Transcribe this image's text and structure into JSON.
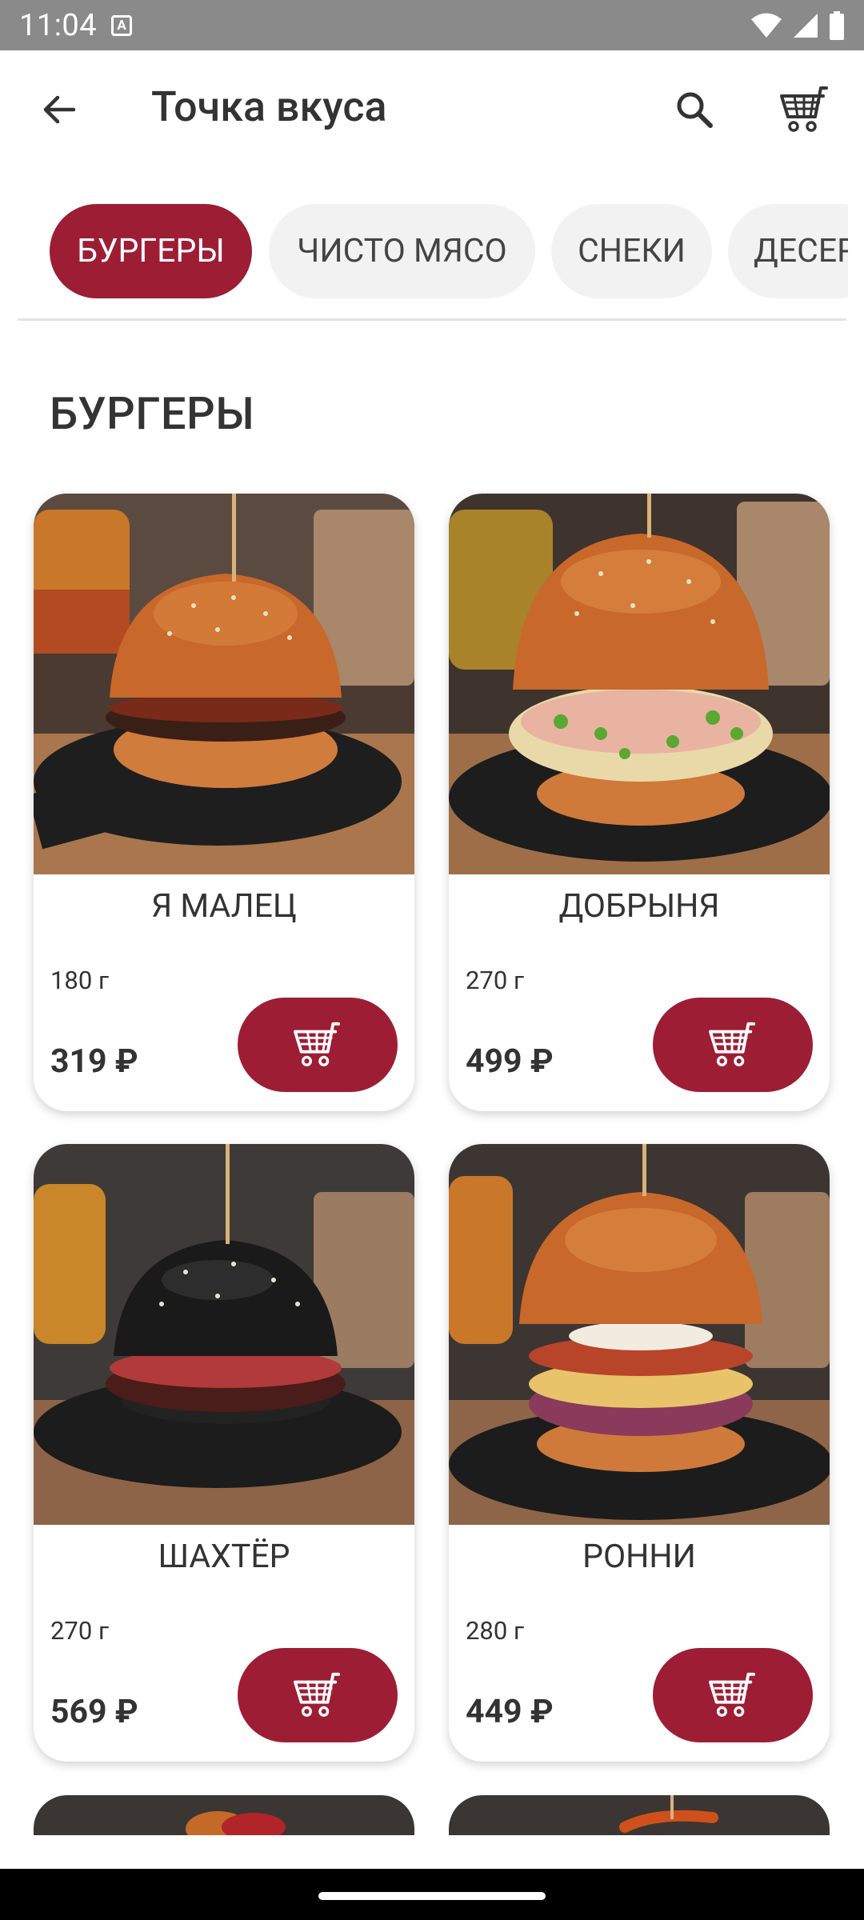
{
  "status_bar": {
    "time": "11:04",
    "badge": "A",
    "icons": [
      "wifi-icon",
      "signal-icon",
      "battery-icon"
    ]
  },
  "app_bar": {
    "title": "Точка вкуса",
    "icons": [
      "back-arrow-icon",
      "search-icon",
      "cart-icon"
    ]
  },
  "categories": [
    {
      "label": "БУРГЕРЫ",
      "active": true
    },
    {
      "label": "ЧИСТО МЯСО",
      "active": false
    },
    {
      "label": "СНЕКИ",
      "active": false
    },
    {
      "label": "ДЕСЕР",
      "active": false
    }
  ],
  "section": {
    "title": "БУРГЕРЫ"
  },
  "products": [
    {
      "name": "Я МАЛЕЦ",
      "weight": "180 г",
      "price": "319 ₽",
      "bun": "brioche"
    },
    {
      "name": "ДОБРЫНЯ",
      "weight": "270 г",
      "price": "499 ₽",
      "bun": "brioche"
    },
    {
      "name": "ШАХТЁР",
      "weight": "270 г",
      "price": "569 ₽",
      "bun": "black"
    },
    {
      "name": "РОННИ",
      "weight": "280 г",
      "price": "449 ₽",
      "bun": "brioche"
    }
  ],
  "colors": {
    "accent": "#9d1d35",
    "chip_bg": "#f2f2f2",
    "text": "#333333",
    "status_bar": "#8a8a8a"
  }
}
